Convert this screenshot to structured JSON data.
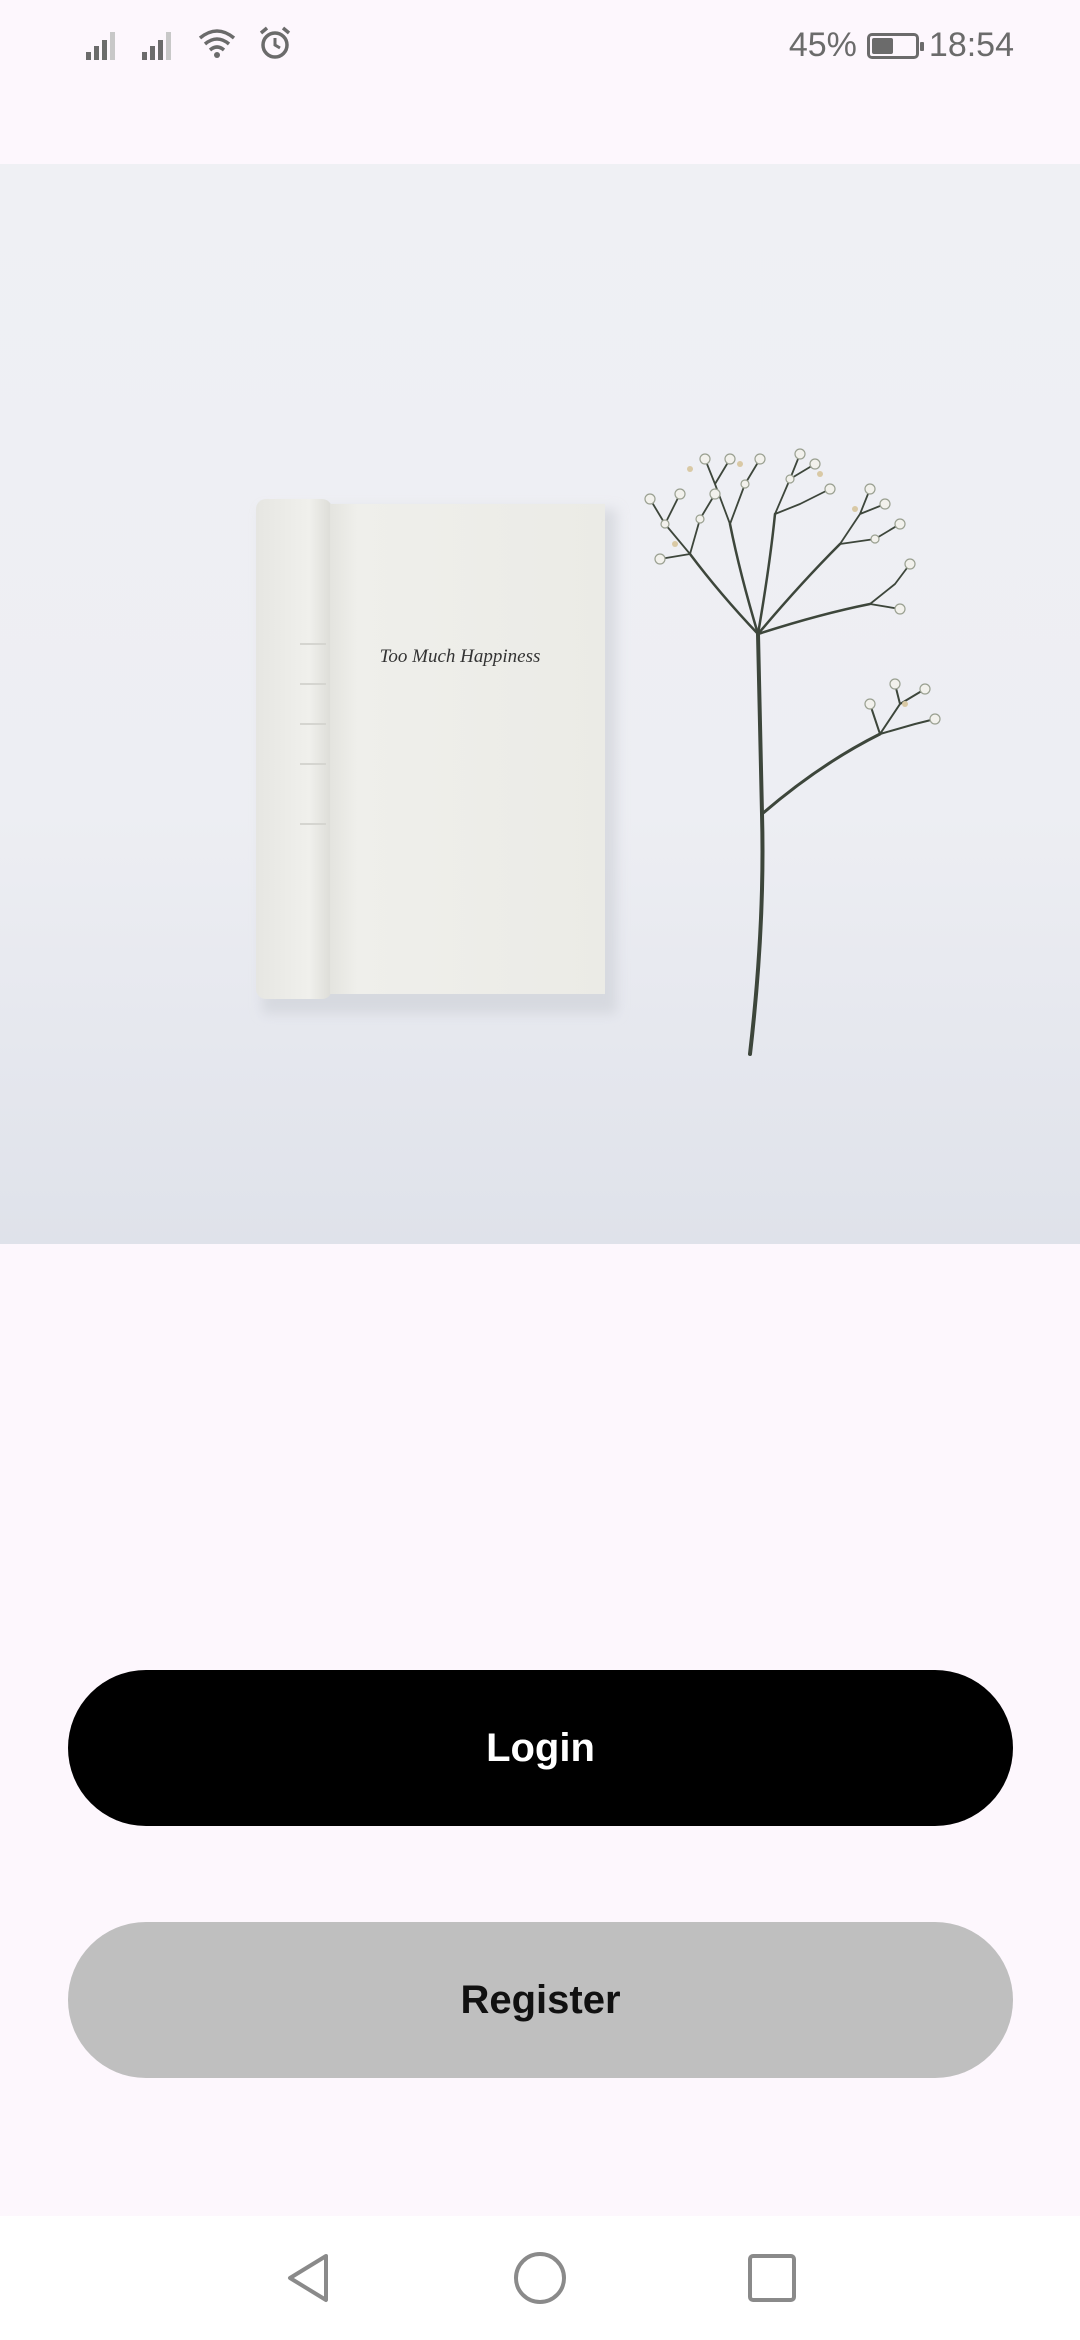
{
  "status_bar": {
    "battery_percent": "45%",
    "battery_level": 0.45,
    "time": "18:54",
    "icons": [
      "signal-icon",
      "signal-icon",
      "wifi-icon",
      "alarm-icon",
      "battery-icon"
    ]
  },
  "hero": {
    "book_title": "Too Much Happiness"
  },
  "actions": {
    "login_label": "Login",
    "register_label": "Register"
  },
  "nav": {
    "icons": [
      "back-icon",
      "home-icon",
      "recents-icon"
    ]
  },
  "colors": {
    "background": "#fdf7fd",
    "login_button": "#000000",
    "register_button": "#bfbfbf"
  }
}
